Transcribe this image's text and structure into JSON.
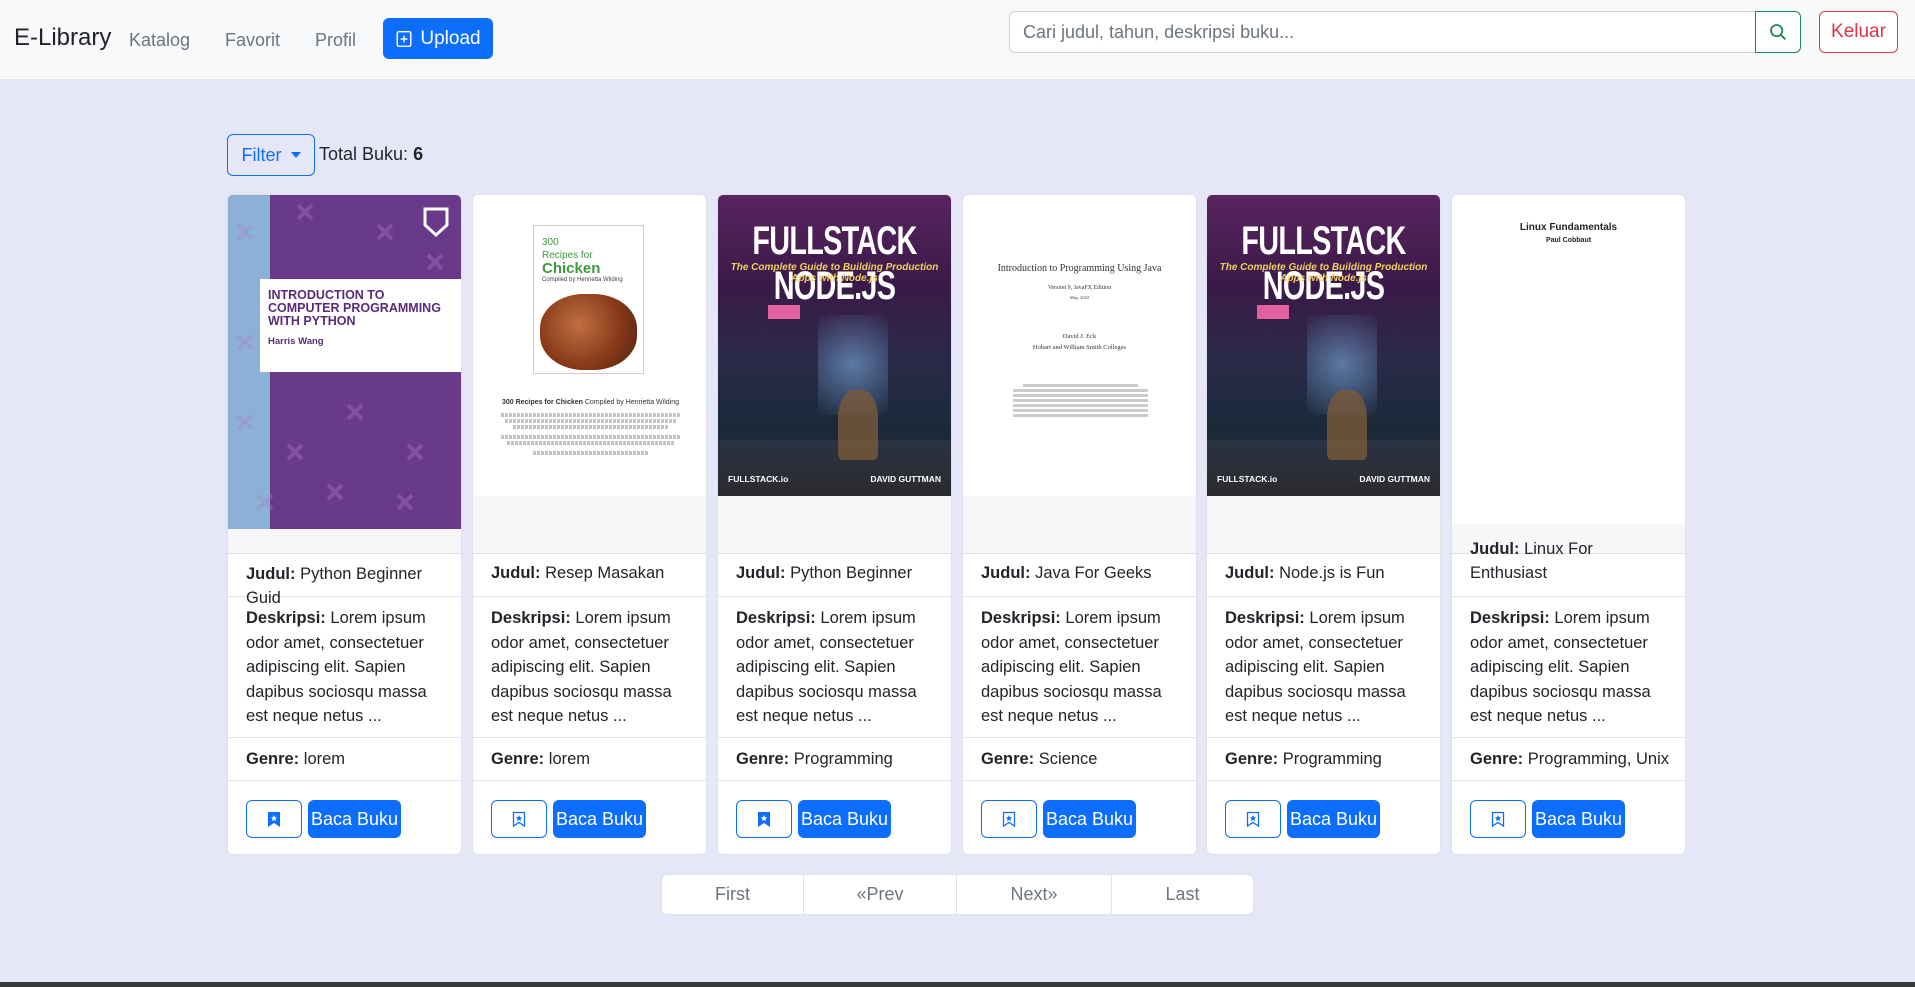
{
  "navbar": {
    "brand": "E-Library",
    "links": [
      "Katalog",
      "Favorit",
      "Profil"
    ],
    "upload_label": "Upload",
    "search_placeholder": "Cari judul, tahun, deskripsi buku...",
    "logout_label": "Keluar"
  },
  "toolbar": {
    "filter_label": "Filter",
    "total_label": "Total Buku:",
    "total_value": "6"
  },
  "labels": {
    "judul": "Judul:",
    "deskripsi": "Deskripsi:",
    "genre": "Genre:",
    "read_button": "Baca Buku"
  },
  "books": [
    {
      "title": "Python Beginner Guid",
      "description": "Lorem ipsum odor amet, consectetuer adipiscing elit. Sapien dapibus sociosqu massa est neque netus ...",
      "genre": "lorem",
      "favorited": true,
      "cover": {
        "title": "INTRODUCTION TO COMPUTER PROGRAMMING WITH PYTHON",
        "author": "Harris Wang"
      }
    },
    {
      "title": "Resep Masakan",
      "description": "Lorem ipsum odor amet, consectetuer adipiscing elit. Sapien dapibus sociosqu massa est neque netus ...",
      "genre": "lorem",
      "favorited": false,
      "cover": {
        "top": "300",
        "line2": "Recipes for",
        "title": "Chicken",
        "author": "Compiled by Henrietta Wilding",
        "heading_bold": "300 Recipes for Chicken",
        "heading_rest": "Compiled by Henrietta Wilding"
      }
    },
    {
      "title": "Python Beginner",
      "description": "Lorem ipsum odor amet, consectetuer adipiscing elit. Sapien dapibus sociosqu massa est neque netus ...",
      "genre": "Programming",
      "favorited": true,
      "cover": {
        "title": "FULLSTACK NODE.JS",
        "subtitle": "The Complete Guide to Building Production Apps with Node.js",
        "publisher": "FULLSTACK.io",
        "author": "DAVID GUTTMAN"
      }
    },
    {
      "title": "Java For Geeks",
      "description": "Lorem ipsum odor amet, consectetuer adipiscing elit. Sapien dapibus sociosqu massa est neque netus ...",
      "genre": "Science",
      "favorited": false,
      "cover": {
        "title": "Introduction to Programming Using Java",
        "edition": "Version 9, JavaFX Edition",
        "date": "May, 2022",
        "author": "David J. Eck",
        "college": "Hobart and William Smith Colleges"
      }
    },
    {
      "title": "Node.js is Fun",
      "description": "Lorem ipsum odor amet, consectetuer adipiscing elit. Sapien dapibus sociosqu massa est neque netus ...",
      "genre": "Programming",
      "favorited": false,
      "cover": {
        "title": "FULLSTACK NODE.JS",
        "subtitle": "The Complete Guide to Building Production Apps with Node.js",
        "publisher": "FULLSTACK.io",
        "author": "DAVID GUTTMAN"
      }
    },
    {
      "title": "Linux For Enthusiast",
      "description": "Lorem ipsum odor amet, consectetuer adipiscing elit. Sapien dapibus sociosqu massa est neque netus ...",
      "genre": "Programming, Unix",
      "favorited": false,
      "cover": {
        "title": "Linux Fundamentals",
        "author": "Paul Cobbaut"
      }
    }
  ],
  "pagination": [
    "First",
    "«Prev",
    "Next»",
    "Last"
  ],
  "colors": {
    "primary": "#0d6efd",
    "danger": "#dc3545",
    "success": "#198754",
    "background": "#e6e6f9"
  }
}
